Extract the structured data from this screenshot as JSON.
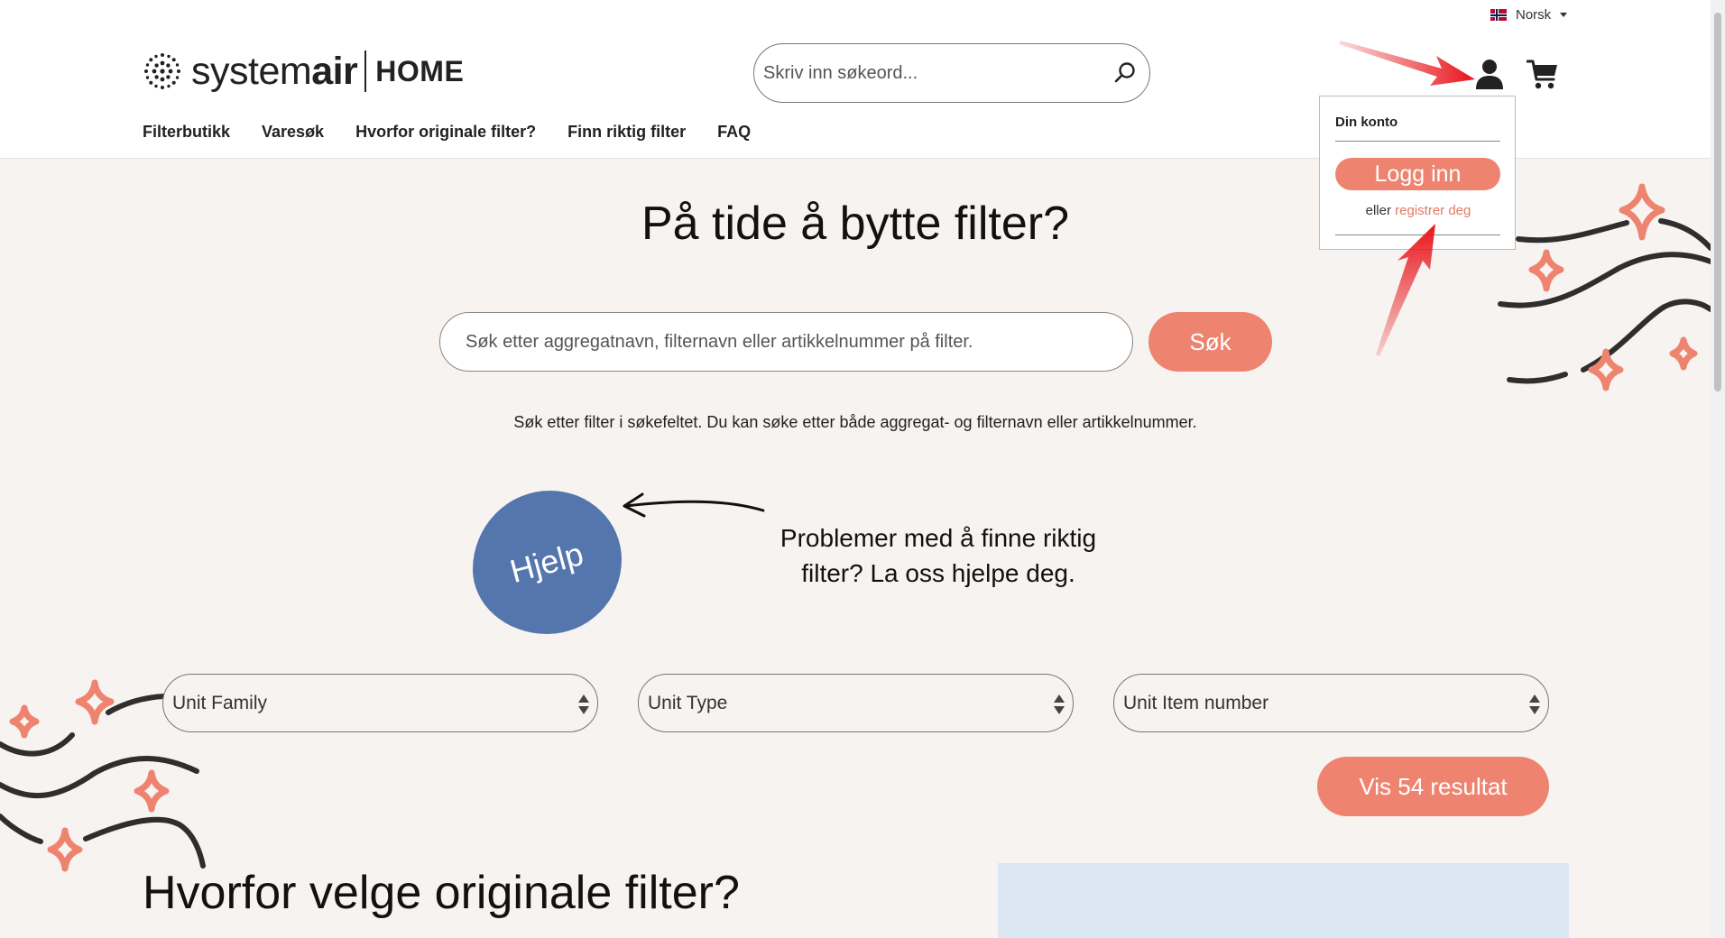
{
  "header": {
    "language": "Norsk",
    "logo": {
      "brand_light": "system",
      "brand_bold": "air",
      "sub": "HOME"
    },
    "search_placeholder": "Skriv inn søkeord...",
    "nav": [
      "Filterbutikk",
      "Varesøk",
      "Hvorfor originale filter?",
      "Finn riktig filter",
      "FAQ"
    ]
  },
  "account_dropdown": {
    "title": "Din konto",
    "login_label": "Logg inn",
    "or_text": "eller",
    "register_link": "registrer deg"
  },
  "hero": {
    "title": "På tide å bytte filter?",
    "search_placeholder": "Søk etter aggregatnavn, filternavn eller artikkelnummer på filter.",
    "search_button": "Søk",
    "helper_text": "Søk etter filter i søkefeltet. Du kan søke etter både aggregat- og filternavn eller artikkelnummer."
  },
  "help": {
    "badge": "Hjelp",
    "text": "Problemer med å finne riktig filter? La oss hjelpe deg."
  },
  "filters": {
    "unit_family": "Unit Family",
    "unit_type": "Unit Type",
    "unit_item_number": "Unit Item number",
    "results_button": "Vis 54 resultat"
  },
  "section": {
    "title": "Hvorfor velge originale filter?"
  },
  "colors": {
    "accent": "#ee8470",
    "help_blue": "#5576ad",
    "background": "#f6f3f0",
    "panel_blue": "#dbe7f3",
    "annotation_red": "#e8141b"
  }
}
